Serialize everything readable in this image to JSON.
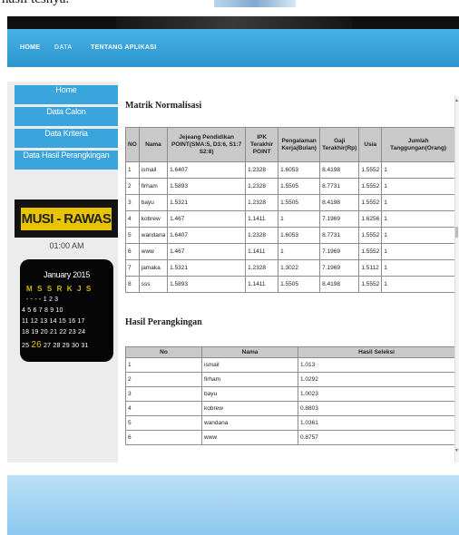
{
  "caption": "hasil tesnya.",
  "nav": {
    "home": "HOME",
    "data": "DATA",
    "about": "TENTANG APLIKASI"
  },
  "colors": {
    "nav_bar": "#2d95cc",
    "menu_item": "#3aa4dd",
    "badge_text_bg": "#e8c400",
    "table_header": "#c9c9c9",
    "footer": "#8bc8ef"
  },
  "sidebar": {
    "menu": [
      {
        "label": "Home"
      },
      {
        "label": "Data Calon"
      },
      {
        "label": "Data Kriteria"
      },
      {
        "label": "Data Hasil Perangkingan"
      }
    ],
    "badge": "MUSI - RAWAS",
    "clock": "01:00 AM",
    "calendar": {
      "title": "January 2015",
      "days": "M S S R K J S",
      "rows": [
        "- - - - 1 2 3",
        "4 5 6 7 8 9 10",
        "11 12 13 14 15 16 17",
        "18 19 20 21 22 23 24",
        "25 26 27 28 29 30 31"
      ],
      "row5_prefix": "25 ",
      "today": "26",
      "row5_suffix": " 27 28 29 30 31"
    }
  },
  "matrix": {
    "title": "Matrik Normalisasi",
    "headers": [
      "NO",
      "Nama",
      "Jejeang Pendidikan POINT(SMA:5, D3:6, S1:7 S2:8)",
      "IPK Terakhir POINT",
      "Pengalaman Kerja(Bulan)",
      "Gaji Terakhir(Rp)",
      "Usia",
      "Jumlah Tanggungan(Orang)"
    ],
    "rows": [
      [
        "1",
        "ismail",
        "1.6407",
        "1.2328",
        "1.6053",
        "8.4198",
        "1.5552",
        "1"
      ],
      [
        "2",
        "firham",
        "1.5893",
        "1.2328",
        "1.5505",
        "8.7731",
        "1.5552",
        "1"
      ],
      [
        "3",
        "bayu",
        "1.5321",
        "1.2328",
        "1.5505",
        "8.4198",
        "1.5552",
        "1"
      ],
      [
        "4",
        "kobrew",
        "1.467",
        "1.1411",
        "1",
        "7.1969",
        "1.6256",
        "1"
      ],
      [
        "5",
        "wandana",
        "1.6407",
        "1.2328",
        "1.6053",
        "8.7731",
        "1.5552",
        "1"
      ],
      [
        "6",
        "www",
        "1.467",
        "1.1411",
        "1",
        "7.1969",
        "1.5552",
        "1"
      ],
      [
        "7",
        "jamaka",
        "1.5321",
        "1.2328",
        "1.3022",
        "7.1969",
        "1.5112",
        "1"
      ],
      [
        "8",
        "sss",
        "1.5893",
        "1.1411",
        "1.5505",
        "8.4198",
        "1.5552",
        "1"
      ]
    ]
  },
  "ranking": {
    "title": "Hasil Perangkingan",
    "headers": [
      "No",
      "Nama",
      "Hasil Seleksi"
    ],
    "rows": [
      [
        "1",
        "ismail",
        "1.013"
      ],
      [
        "2",
        "firham",
        "1.0292"
      ],
      [
        "3",
        "bayu",
        "1.0023"
      ],
      [
        "4",
        "kobrew",
        "0.8803"
      ],
      [
        "5",
        "wandana",
        "1.0361"
      ],
      [
        "6",
        "www",
        "0.8757"
      ]
    ]
  }
}
